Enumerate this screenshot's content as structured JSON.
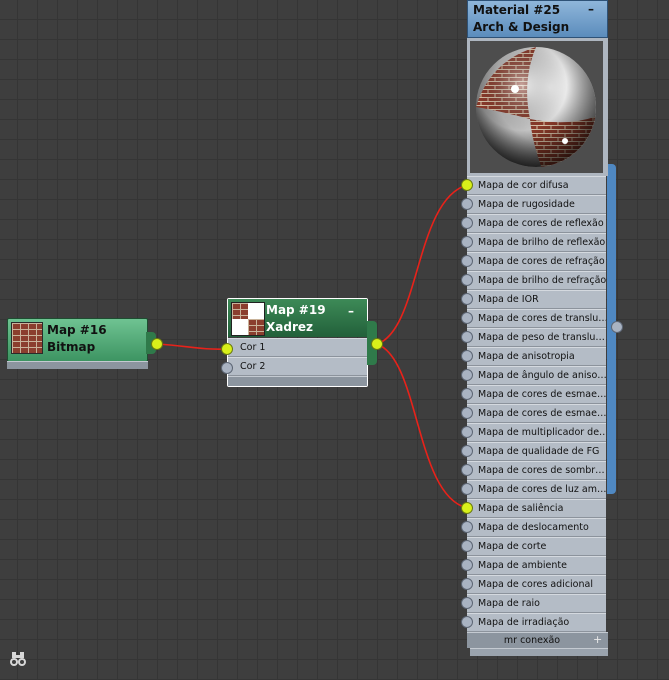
{
  "nodes": {
    "bitmap": {
      "line1": "Map #16",
      "line2": "Bitmap"
    },
    "checker": {
      "line1": "Map #19",
      "line2": "Xadrez",
      "collapse": "–",
      "slots": [
        "Cor 1",
        "Cor 2"
      ]
    },
    "material": {
      "line1": "Material #25",
      "line2": "Arch & Design",
      "collapse": "–",
      "footer": "mr conexão",
      "footer_plus": "+",
      "slots": [
        "Mapa de cor difusa",
        "Mapa de rugosidade",
        "Mapa de cores de reflexão",
        "Mapa de brilho de reflexão",
        "Mapa de cores de refração",
        "Mapa de brilho de refração",
        "Mapa de IOR",
        "Mapa de cores de translu…",
        "Mapa de peso de translu…",
        "Mapa de anisotropia",
        "Mapa de ângulo de aniso…",
        "Mapa de cores de esmae…",
        "Mapa de cores de esmae…",
        "Mapa de multiplicador de…",
        "Mapa de qualidade de FG",
        "Mapa de cores de sombr…",
        "Mapa de cores de luz am…",
        "Mapa de saliência",
        "Mapa de deslocamento",
        "Mapa de corte",
        "Mapa de ambiente",
        "Mapa de cores adicional",
        "Mapa de raio",
        "Mapa de irradiação"
      ],
      "connected_slots": [
        0,
        17
      ]
    }
  },
  "colors": {
    "wire": "#e8221a",
    "port_connected": "#d8f01a",
    "map_header_green": "#2f7a4a",
    "material_header_blue": "#6f9cc6",
    "selected_outline": "#ffffff"
  },
  "icons": {
    "navigator": "binoculars-icon"
  }
}
